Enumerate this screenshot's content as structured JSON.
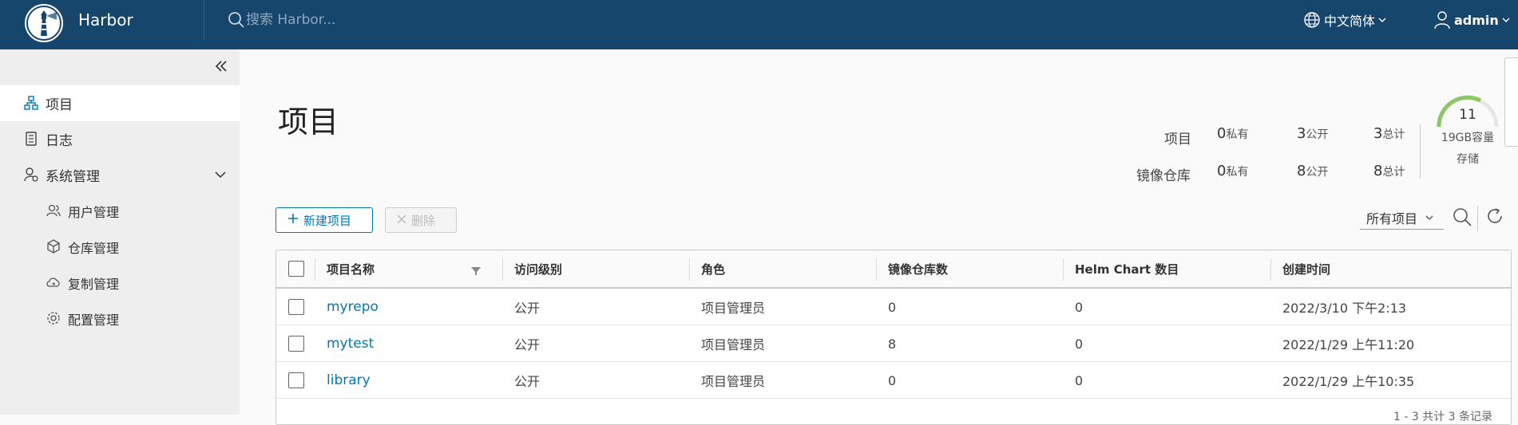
{
  "header": {
    "brand": "Harbor",
    "search_placeholder": "搜索 Harbor...",
    "language": "中文简体",
    "user": "admin"
  },
  "sidebar": {
    "items": [
      {
        "label": "项目",
        "icon": "projects-icon",
        "active": true
      },
      {
        "label": "日志",
        "icon": "logs-icon"
      },
      {
        "label": "系统管理",
        "icon": "admin-icon",
        "expanded": true
      },
      {
        "label": "用户管理",
        "icon": "users-icon",
        "sub": true
      },
      {
        "label": "仓库管理",
        "icon": "registry-icon",
        "sub": true
      },
      {
        "label": "复制管理",
        "icon": "replication-icon",
        "sub": true
      },
      {
        "label": "配置管理",
        "icon": "config-icon",
        "sub": true
      }
    ]
  },
  "page": {
    "title": "项目"
  },
  "stats": {
    "projects_label": "项目",
    "repos_label": "镜像仓库",
    "private_unit": "私有",
    "public_unit": "公开",
    "total_unit": "总计",
    "projects": {
      "private": "0",
      "public": "3",
      "total": "3"
    },
    "repos": {
      "private": "0",
      "public": "8",
      "total": "8"
    },
    "storage_value": "11",
    "storage_capacity": "19GB容量",
    "storage_label": "存储"
  },
  "toolbar": {
    "new_label": "新建项目",
    "delete_label": "删除",
    "filter_value": "所有项目"
  },
  "table": {
    "columns": [
      "项目名称",
      "访问级别",
      "角色",
      "镜像仓库数",
      "Helm Chart 数目",
      "创建时间"
    ],
    "rows": [
      {
        "name": "myrepo",
        "access": "公开",
        "role": "项目管理员",
        "repos": "0",
        "charts": "0",
        "created": "2022/3/10 下午2:13"
      },
      {
        "name": "mytest",
        "access": "公开",
        "role": "项目管理员",
        "repos": "8",
        "charts": "0",
        "created": "2022/1/29 上午11:20"
      },
      {
        "name": "library",
        "access": "公开",
        "role": "项目管理员",
        "repos": "0",
        "charts": "0",
        "created": "2022/1/29 上午10:35"
      }
    ],
    "footer": "1 - 3 共计 3 条记录"
  },
  "colors": {
    "header_bg": "#17466c",
    "accent": "#0079b8",
    "gauge": "#8cc665"
  }
}
